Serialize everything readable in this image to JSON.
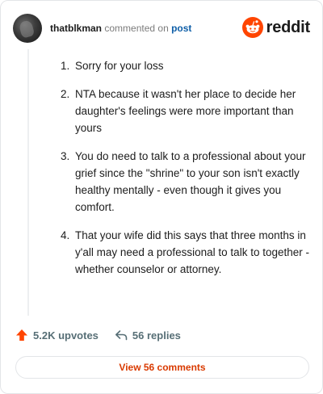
{
  "header": {
    "username": "thatblkman",
    "action_text": "commented on",
    "link_text": "post",
    "logo_text": "reddit"
  },
  "comment": {
    "items": [
      {
        "number": "1.",
        "text": "Sorry for your loss"
      },
      {
        "number": "2.",
        "text": "NTA because it wasn't her place to decide her daughter's feelings were more important than yours"
      },
      {
        "number": "3.",
        "text": "You do need to talk to a professional about your grief since the \"shrine\" to your son isn't exactly healthy mentally - even though it gives you comfort."
      },
      {
        "number": "4.",
        "text": "That your wife did this says that three months in y'all may need a professional to talk to together - whether counselor or attorney."
      }
    ]
  },
  "actions": {
    "upvotes": "5.2K upvotes",
    "replies": "56 replies"
  },
  "view_comments_label": "View 56 comments",
  "colors": {
    "brand": "#ff4500",
    "link": "#0f5fa8",
    "view_button_text": "#d93a00",
    "muted": "#576f76"
  }
}
